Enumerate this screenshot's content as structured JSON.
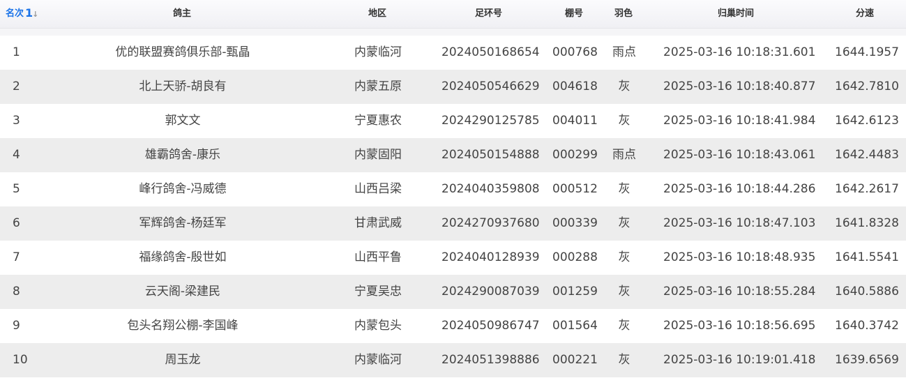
{
  "header": {
    "rank": "名次",
    "sort_indicator": "1",
    "owner": "鸽主",
    "region": "地区",
    "ring": "足环号",
    "loft": "棚号",
    "color": "羽色",
    "arrival": "归巢时间",
    "speed": "分速"
  },
  "sort_icon": "sort-asc-icon",
  "colors": {
    "accent": "#1a73e8",
    "row_alt": "#ededed",
    "header_bg": "#f3f3f6"
  },
  "rows": [
    {
      "rank": "1",
      "owner": "优的联盟赛鸽俱乐部-甄晶",
      "region": "内蒙临河",
      "ring": "2024050168654",
      "loft": "000768",
      "color": "雨点",
      "arrival": "2025-03-16 10:18:31.601",
      "speed": "1644.1957"
    },
    {
      "rank": "2",
      "owner": "北上天骄-胡良有",
      "region": "内蒙五原",
      "ring": "2024050546629",
      "loft": "004618",
      "color": "灰",
      "arrival": "2025-03-16 10:18:40.877",
      "speed": "1642.7810"
    },
    {
      "rank": "3",
      "owner": "郭文文",
      "region": "宁夏惠农",
      "ring": "2024290125785",
      "loft": "004011",
      "color": "灰",
      "arrival": "2025-03-16 10:18:41.984",
      "speed": "1642.6123"
    },
    {
      "rank": "4",
      "owner": "雄霸鸽舍-康乐",
      "region": "内蒙固阳",
      "ring": "2024050154888",
      "loft": "000299",
      "color": "雨点",
      "arrival": "2025-03-16 10:18:43.061",
      "speed": "1642.4483"
    },
    {
      "rank": "5",
      "owner": "峰行鸽舍-冯威德",
      "region": "山西吕梁",
      "ring": "2024040359808",
      "loft": "000512",
      "color": "灰",
      "arrival": "2025-03-16 10:18:44.286",
      "speed": "1642.2617"
    },
    {
      "rank": "6",
      "owner": "军辉鸽舍-杨廷军",
      "region": "甘肃武威",
      "ring": "2024270937680",
      "loft": "000339",
      "color": "灰",
      "arrival": "2025-03-16 10:18:47.103",
      "speed": "1641.8328"
    },
    {
      "rank": "7",
      "owner": "福缘鸽舍-殷世如",
      "region": "山西平鲁",
      "ring": "2024040128939",
      "loft": "000288",
      "color": "灰",
      "arrival": "2025-03-16 10:18:48.935",
      "speed": "1641.5541"
    },
    {
      "rank": "8",
      "owner": "云天阁-梁建民",
      "region": "宁夏吴忠",
      "ring": "2024290087039",
      "loft": "001259",
      "color": "灰",
      "arrival": "2025-03-16 10:18:55.284",
      "speed": "1640.5886"
    },
    {
      "rank": "9",
      "owner": "包头名翔公棚-李国峰",
      "region": "内蒙包头",
      "ring": "2024050986747",
      "loft": "001564",
      "color": "灰",
      "arrival": "2025-03-16 10:18:56.695",
      "speed": "1640.3742"
    },
    {
      "rank": "10",
      "owner": "周玉龙",
      "region": "内蒙临河",
      "ring": "2024051398886",
      "loft": "000221",
      "color": "灰",
      "arrival": "2025-03-16 10:19:01.418",
      "speed": "1639.6569"
    }
  ]
}
